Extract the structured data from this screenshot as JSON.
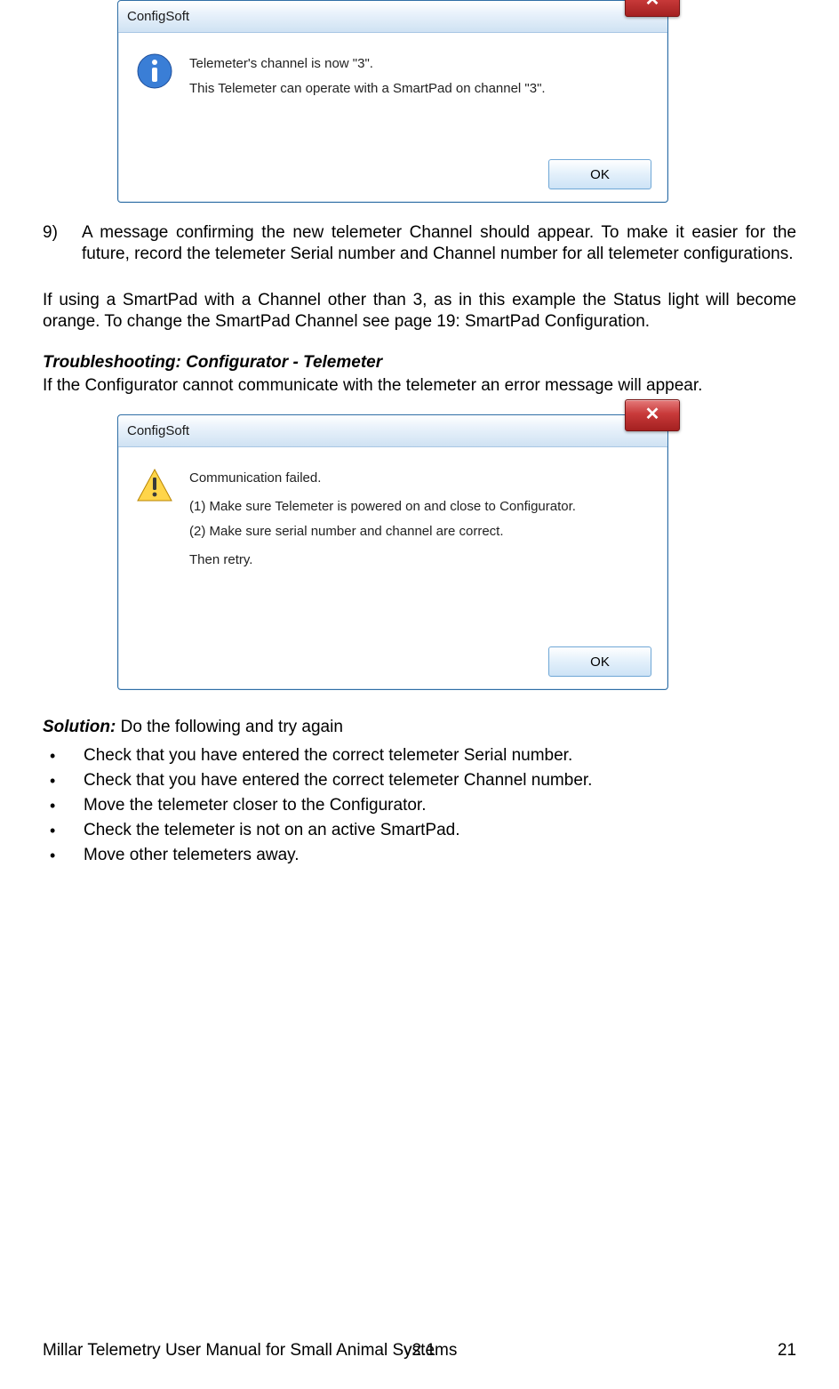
{
  "dialog1": {
    "title": "ConfigSoft",
    "line1": "Telemeter's channel is now \"3\".",
    "line2": "This Telemeter can operate with a SmartPad on channel \"3\".",
    "ok": "OK"
  },
  "step9": {
    "num": "9)",
    "text": "A message confirming the new telemeter Channel should appear.  To make it easier for the future, record the telemeter Serial number and Channel number for all telemeter configurations."
  },
  "para1": "If using a SmartPad with a Channel other than 3, as in this example the Status light will become orange.  To change the SmartPad Channel see page 19: SmartPad Configuration.",
  "subhead": "Troubleshooting: Configurator - Telemeter",
  "subhead_follow": "If the Configurator cannot communicate with the telemeter an error message will appear.",
  "dialog2": {
    "title": "ConfigSoft",
    "l1": "Communication failed.",
    "l2": "(1) Make sure Telemeter is powered on and close to Configurator.",
    "l3": "(2) Make sure serial number and channel are correct.",
    "l4": "Then retry.",
    "ok": "OK"
  },
  "solution_lead": "Solution:",
  "solution_rest": " Do the following and try again",
  "bullets": [
    "Check that you have entered the correct telemeter Serial number.",
    "Check that you have entered the correct telemeter Channel number.",
    "Move the telemeter closer to the Configurator.",
    "Check the telemeter is not on an active SmartPad.",
    "Move other telemeters away."
  ],
  "footer": {
    "left": "Millar Telemetry User Manual for Small Animal Systems",
    "mid": "v2.1",
    "right": "21"
  }
}
